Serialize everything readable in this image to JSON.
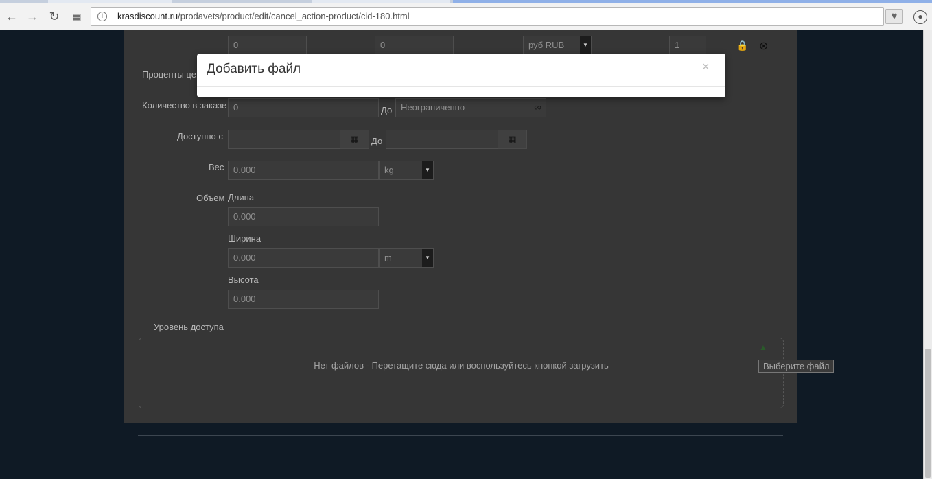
{
  "browser": {
    "url_domain": "krasdiscount.ru",
    "url_path": "/prodavets/product/edit/cancel_action-product/cid-180.html",
    "back_icon": "arrow-left-icon",
    "forward_icon": "arrow-right-icon",
    "reload_icon": "reload-icon",
    "apps_icon": "apps-grid-icon",
    "site_info_icon": "site-info-icon",
    "bookmark_icon": "heart-icon",
    "profile_icon": "user-icon"
  },
  "price_row": {
    "price_value": "0",
    "price_with_tax_value": "0",
    "currency_value": "руб RUB",
    "min_qty_value": "1"
  },
  "form": {
    "percent_label": "Проценты це",
    "quantity_label": "Количество в заказе",
    "quantity_from": "0",
    "quantity_to_label": "До",
    "quantity_to": "Неограниченно",
    "infinity_symbol": "∞",
    "available_label": "Доступно с",
    "available_to_label": "До",
    "weight_label": "Вес",
    "weight_value": "0.000",
    "weight_unit": "kg",
    "volume_label": "Объем",
    "length_label": "Длина",
    "length_value": "0.000",
    "width_label": "Ширина",
    "width_value": "0.000",
    "dimension_unit": "m",
    "height_label": "Высота",
    "height_value": "0.000",
    "access_label": "Уровень доступа"
  },
  "upload": {
    "empty_message": "Нет файлов - Перетащите сюда или воспользуйтесь кнопкой загрузить",
    "choose_file": "Выберите файл"
  },
  "modal": {
    "title": "Добавить файл",
    "close": "×"
  }
}
